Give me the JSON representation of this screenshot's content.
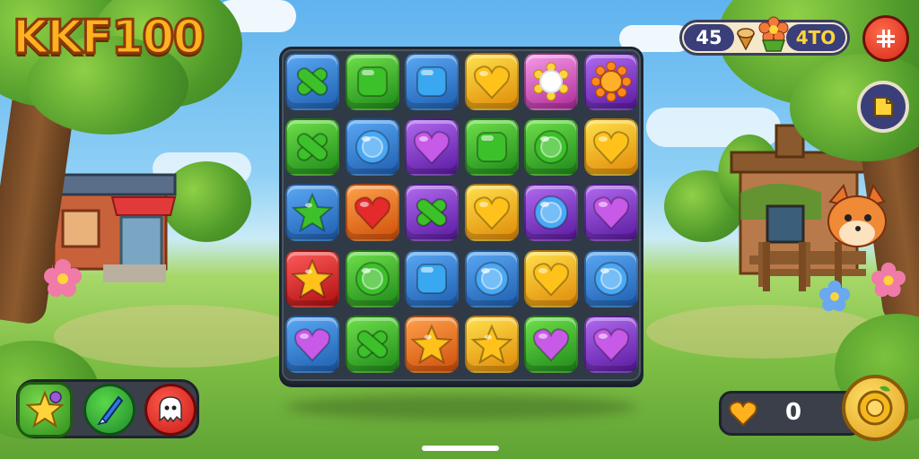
{
  "game": {
    "logo_text": "KKF100"
  },
  "hud": {
    "level": "45",
    "score": "4TO",
    "coins": "0"
  },
  "board": {
    "rows": 5,
    "cols": 6,
    "tiles": [
      [
        "x-blue",
        "square-green",
        "square-blue",
        "heart-yellow",
        "flower-pink",
        "sun-purple"
      ],
      [
        "x-green",
        "orb-blue",
        "heart-purple",
        "square-green",
        "orb-green",
        "heart-yellow"
      ],
      [
        "star-blue",
        "heart-orange",
        "x-purple",
        "heart-yellow",
        "orb-purple",
        "heart-purple"
      ],
      [
        "star-red",
        "orb-green",
        "square-blue",
        "orb-blue",
        "heart-yellow",
        "orb-blue"
      ],
      [
        "heart-blue",
        "x-green",
        "star-orange",
        "star-yellow",
        "heart-green",
        "heart-purple"
      ]
    ]
  },
  "boosters": [
    {
      "icon": "star-icon",
      "color": "#49b83a"
    },
    {
      "icon": "paint-brush-icon",
      "color": "#2da33a"
    },
    {
      "icon": "ghost-icon",
      "color": "#e43a3a"
    }
  ],
  "colors": {
    "blue": "#2f86e0",
    "green": "#3cc12a",
    "yellow": "#ffc21a",
    "pink": "#e75ccf",
    "purple": "#8a3ad6",
    "orange": "#ff7a18",
    "red": "#e42a2a"
  }
}
